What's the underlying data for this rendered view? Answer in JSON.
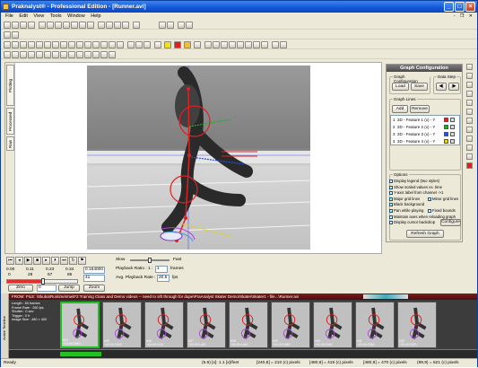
{
  "app": {
    "title": "Praknalyst® - Professional Edition - [Runner.avi]"
  },
  "menu": {
    "items": [
      "File",
      "Edit",
      "View",
      "Tools",
      "Window",
      "Help"
    ],
    "mdi_controls": "- ❐ ✕"
  },
  "graph_config": {
    "title": "Graph Configuration",
    "group_label": "Graph Configuration",
    "load": "Load",
    "save": "Save",
    "datastep_label": "Data Step",
    "prev": "◀|",
    "next": "|▶",
    "lines_label": "Graph Lines",
    "add": "Add",
    "remove": "Remove",
    "lines": [
      {
        "num": "1",
        "name": "2D - Feature 1 (x) - Y",
        "color": "#e02020"
      },
      {
        "num": "2",
        "name": "2D - Feature 2 (x) - Y",
        "color": "#20b020"
      },
      {
        "num": "3",
        "name": "2D - Feature 3 (x) - Y",
        "color": "#2050e0"
      },
      {
        "num": "4",
        "name": "2D - Feature 4 (x) - Y",
        "color": "#e0d020"
      }
    ],
    "options_label": "Options",
    "options": {
      "display_legend": "Display legend (two styles)",
      "show_scaled": "Show scaled values vs. time",
      "y_axis_label": "Y-axis label from channel ->1",
      "major_grid": "Major grid lines",
      "minor_grid": "Minor grid lines",
      "black_bg": "Black background",
      "pan_zoom": "Pan while playing",
      "fixed_bounds": "Fixed bounds",
      "maintain_axes": "Maintain axes when reloading graph",
      "display_cursor": "Display cursor backdrop",
      "configure": "Configure",
      "refresh": "Refresh Graph"
    }
  },
  "sidebar_tabs": [
    "Plotting",
    "Processed",
    "Raw"
  ],
  "playback": {
    "times": [
      "0.00",
      "0.11",
      "0.23",
      "0.34"
    ],
    "frames": [
      "0",
      "28",
      "57",
      "85"
    ],
    "time_value": "0.164000",
    "frame_value": "41",
    "zero": "Zero",
    "jump_value": "0",
    "jump": "Jump",
    "zoom": "Zoom",
    "slow": "Slow",
    "fast": "Fast",
    "ratio_label": "Playback Ratio : 1 :",
    "ratio_value": "1",
    "ratio_unit": "frames",
    "avg_label": "Avg. Playback Rate :",
    "avg_value": "20.5",
    "avg_unit": "fps"
  },
  "filmstrip": {
    "header": "FROM: FILE: \\Skuba\\Runtime\\mw\\F2 Training Class and Demo videos -- need to sift through for dupe\\PraAnalyst Skater Demo\\Skater\\Skater1 - file...\\Runner.avi",
    "side_label": "Active Timeline",
    "info": [
      "Length : 60 frames",
      "Frame Rate : 250 fps",
      "Shutter : 0 sec",
      "Trigger : 0 fr",
      "Image Size : 480 × 400"
    ],
    "frames": [
      {
        "label": "#24",
        "time": "+00:00:0960"
      },
      {
        "label": "#25",
        "time": "+00:00:1000"
      },
      {
        "label": "#26",
        "time": "+00:00:1120"
      },
      {
        "label": "#27",
        "time": "+00:00:1480"
      },
      {
        "label": "#28",
        "time": "+00:00:1640"
      },
      {
        "label": "#29",
        "time": "+00:00:1680"
      },
      {
        "label": "#30",
        "time": "+00:00:2040"
      },
      {
        "label": "#31",
        "time": "+00:00:2280"
      },
      {
        "label": "#32",
        "time": "+00:00:2320"
      }
    ]
  },
  "status": {
    "ready": "Ready",
    "items": [
      "(5.6) [x]: 1.1 [x]/feet",
      "[240,8] = 210 (c) pixels",
      "[480,9] = 415 (c) pixels",
      "[480,9] = 470 (c) pixels",
      "(99,9) = 521 (c) pixels"
    ]
  },
  "colors": {
    "titlebar": "#1455d6",
    "panel_header": "#5a5a5a",
    "strip_header": "#6a1717",
    "selected_frame": "#22c022"
  }
}
